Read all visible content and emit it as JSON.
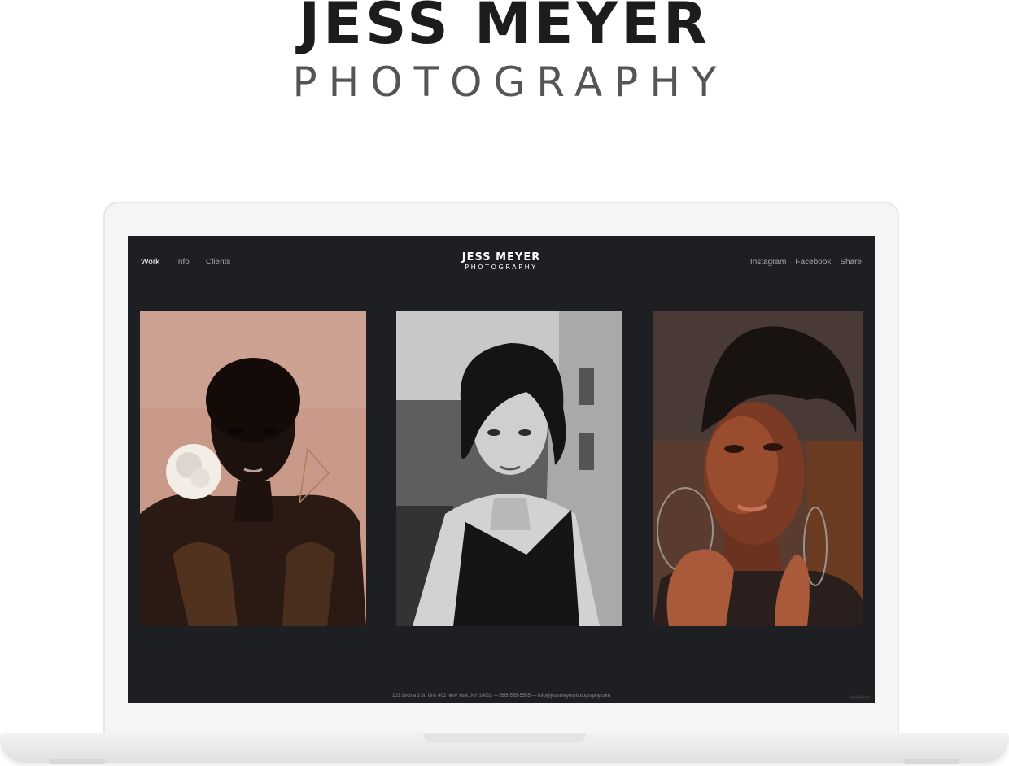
{
  "brand": {
    "title": "JESS MEYER",
    "subtitle": "PHOTOGRAPHY"
  },
  "site": {
    "nav_left": [
      "Work",
      "Info",
      "Clients"
    ],
    "active": "Work",
    "logo": {
      "line1": "JESS MEYER",
      "line2": "PHOTOGRAPHY"
    },
    "nav_right": [
      "Instagram",
      "Facebook",
      "Share"
    ],
    "footer": "103 Orchard St, Unit 402 New York, NY 10002 — 555-555-5555 — info@jessmeyerphotography.com",
    "credit": "Jess Meyer"
  },
  "photos": [
    {
      "name": "portrait-peach-background",
      "tone": "#c99a8a"
    },
    {
      "name": "portrait-black-and-white",
      "tone": "#8d8d8d"
    },
    {
      "name": "portrait-warm-light",
      "tone": "#6b4a3c"
    }
  ]
}
